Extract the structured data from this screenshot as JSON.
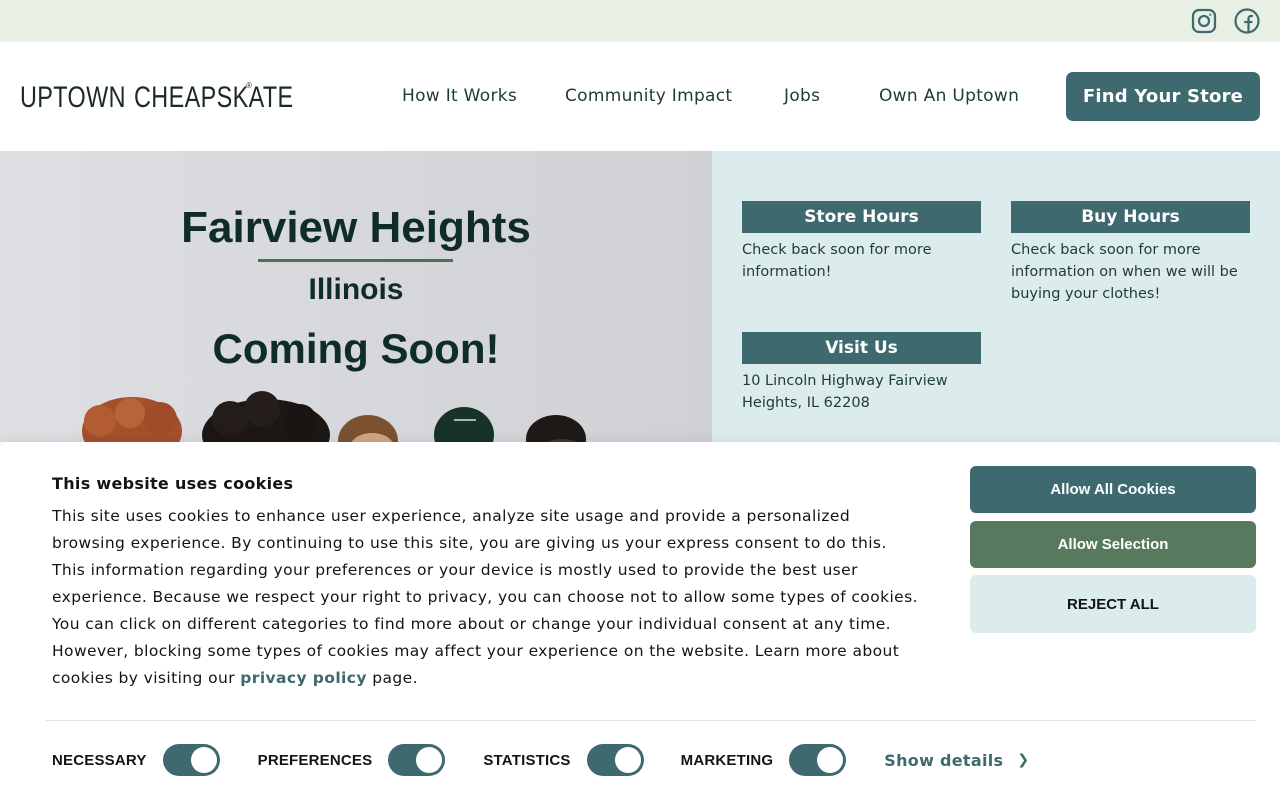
{
  "social": {
    "icons": [
      "instagram-icon",
      "facebook-icon"
    ]
  },
  "header": {
    "logo_word1": "UPTOWN",
    "logo_word2": "CHEAPSKATE",
    "logo_reg": "®",
    "nav": [
      "How It Works",
      "Community Impact",
      "Jobs",
      "Own An Uptown"
    ],
    "cta": "Find Your Store"
  },
  "hero": {
    "city": "Fairview Heights",
    "state": "Illinois",
    "status": "Coming Soon!"
  },
  "info": {
    "store_hours": {
      "title": "Store Hours",
      "text": "Check back soon for more information!"
    },
    "buy_hours": {
      "title": "Buy Hours",
      "text": "Check back soon for more information on when we will be buying your clothes!"
    },
    "visit": {
      "title": "Visit Us",
      "text": "10 Lincoln Highway Fairview Heights, IL 62208"
    }
  },
  "cookie": {
    "title": "This website uses cookies",
    "body": "This site uses cookies to enhance user experience, analyze site usage and provide a personalized browsing experience. By continuing to use this site, you are giving us your express consent to do this. This information regarding your preferences or your device is mostly used to provide the best user experience. Because we respect your right to privacy, you can choose not to allow some types of cookies. You can click on different categories to find more about or change your individual consent at any time. However, blocking some types of cookies may affect your experience on the website. Learn more about cookies by visiting our",
    "link": "privacy policy",
    "body_end": " page.",
    "allow_all": "Allow All Cookies",
    "allow_selection": "Allow Selection",
    "reject_all": "REJECT ALL",
    "toggles": [
      {
        "label": "NECESSARY",
        "on": true
      },
      {
        "label": "PREFERENCES",
        "on": true
      },
      {
        "label": "STATISTICS",
        "on": true
      },
      {
        "label": "MARKETING",
        "on": true
      }
    ],
    "show_details": "Show details"
  },
  "colors": {
    "brand_teal": "#3e6a6f",
    "brand_green": "#577a5e",
    "pale_teal": "#dcecec",
    "topbar": "#e8efe4"
  }
}
